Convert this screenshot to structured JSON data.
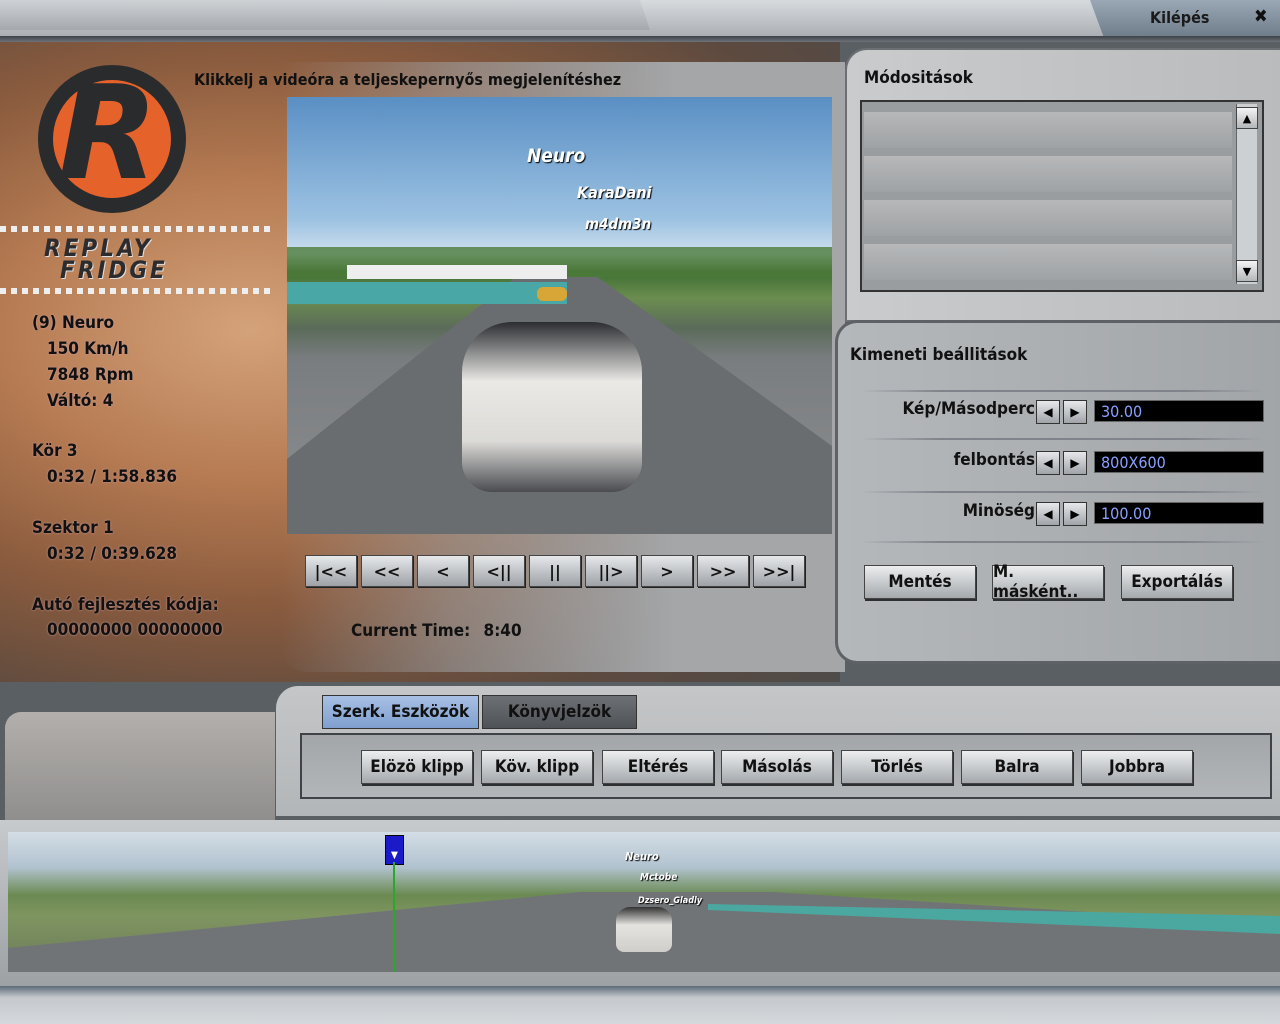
{
  "header": {
    "exit_label": "Kilépés",
    "exit_icon": "close-icon"
  },
  "logo": {
    "line1": "REPLAY",
    "line2": "FRIDGE"
  },
  "driver_info": {
    "name": "(9) Neuro",
    "speed": "150 Km/h",
    "rpm": "7848 Rpm",
    "gear": "Váltó: 4",
    "lap_label": "Kör 3",
    "lap_time": "0:32 / 1:58.836",
    "sector_label": "Szektor 1",
    "sector_time": "0:32 / 0:39.628",
    "upgrade_label": "Autó fejlesztés kódja:",
    "upgrade_code": "00000000 00000000"
  },
  "video": {
    "hint": "Klikkelj a videóra a teljeskepernyős megjelenítéshez",
    "name_tags": [
      "Neuro",
      "KaraDani",
      "m4dm3n"
    ]
  },
  "playback": {
    "buttons": [
      "|<<",
      "<<",
      "<",
      "<||",
      "||",
      "||>",
      ">",
      ">>",
      ">>|"
    ],
    "current_time_label": "Current Time:",
    "current_time": "8:40"
  },
  "modifications": {
    "title": "Módositások",
    "rows": 4
  },
  "output_settings": {
    "title": "Kimeneti beállitások",
    "fields": [
      {
        "label": "Kép/Másodperc",
        "value": "30.00"
      },
      {
        "label": "felbontás",
        "value": "800X600"
      },
      {
        "label": "Minöség",
        "value": "100.00"
      }
    ],
    "buttons": [
      "Mentés",
      "M. másként..",
      "Exportálás"
    ]
  },
  "editor": {
    "tabs": [
      {
        "label": "Szerk. Eszközök",
        "active": true
      },
      {
        "label": "Könyvjelzök",
        "active": false
      }
    ],
    "buttons": [
      "Elözö klipp",
      "Köv. klipp",
      "Eltérés",
      "Másolás",
      "Törlés",
      "Balra",
      "Jobbra"
    ]
  },
  "timeline": {
    "name_tags": [
      "Neuro",
      "Mctobe",
      "Dzsero_Gladly"
    ]
  },
  "colors": {
    "accent_orange": "#e6622b",
    "value_text": "#8aa0ff",
    "active_tab": "#7f9fcf"
  }
}
